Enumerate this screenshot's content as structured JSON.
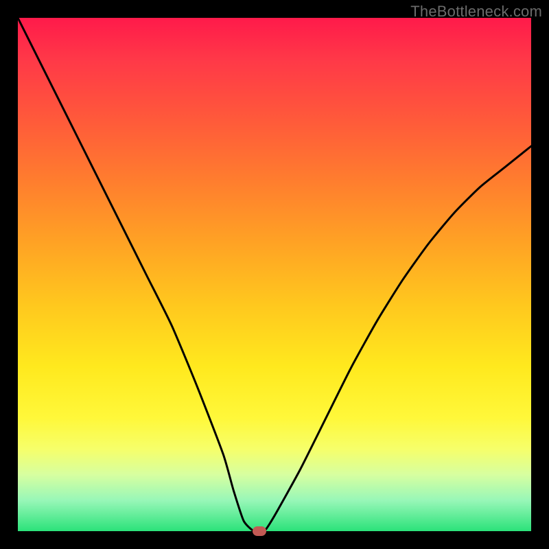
{
  "watermark": "TheBottleneck.com",
  "chart_data": {
    "type": "line",
    "title": "",
    "xlabel": "",
    "ylabel": "",
    "xlim": [
      0,
      100
    ],
    "ylim": [
      0,
      100
    ],
    "grid": false,
    "legend": false,
    "series": [
      {
        "name": "bottleneck-curve",
        "x": [
          0,
          5,
          10,
          15,
          20,
          25,
          30,
          35,
          40,
          42,
          44,
          46,
          48,
          50,
          55,
          60,
          65,
          70,
          75,
          80,
          85,
          90,
          95,
          100
        ],
        "y": [
          100,
          90,
          80,
          70,
          60,
          50,
          40,
          28,
          15,
          8,
          2,
          0,
          0,
          3,
          12,
          22,
          32,
          41,
          49,
          56,
          62,
          67,
          71,
          75
        ]
      }
    ],
    "marker": {
      "x": 47,
      "y": 0
    },
    "gradient_stops": [
      {
        "pos": 0,
        "color": "#ff1a4a"
      },
      {
        "pos": 50,
        "color": "#ffd21e"
      },
      {
        "pos": 85,
        "color": "#f6ff6a"
      },
      {
        "pos": 100,
        "color": "#2be27a"
      }
    ]
  }
}
